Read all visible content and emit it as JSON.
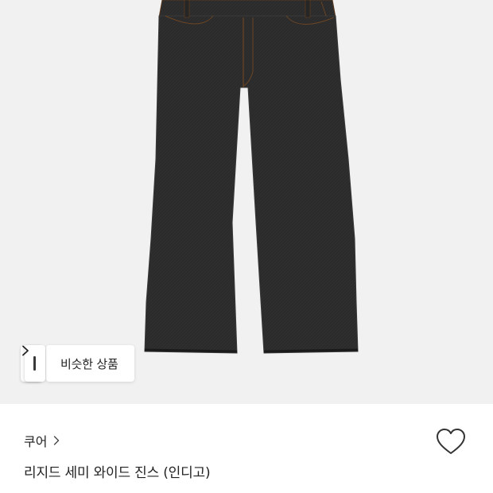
{
  "product_image": {
    "alt_subject": "jeans-photo",
    "background": "#f1f1f1",
    "denim_color": "#2a2a2a"
  },
  "similar_products": {
    "label": "비슷한 상품",
    "icon": "chevron-right-icon"
  },
  "product_info": {
    "brand": "쿠어",
    "brand_icon": "chevron-right-icon",
    "title": "리지드 세미 와이드 진스 (인디고)",
    "wishlist_icon": "heart-icon"
  }
}
